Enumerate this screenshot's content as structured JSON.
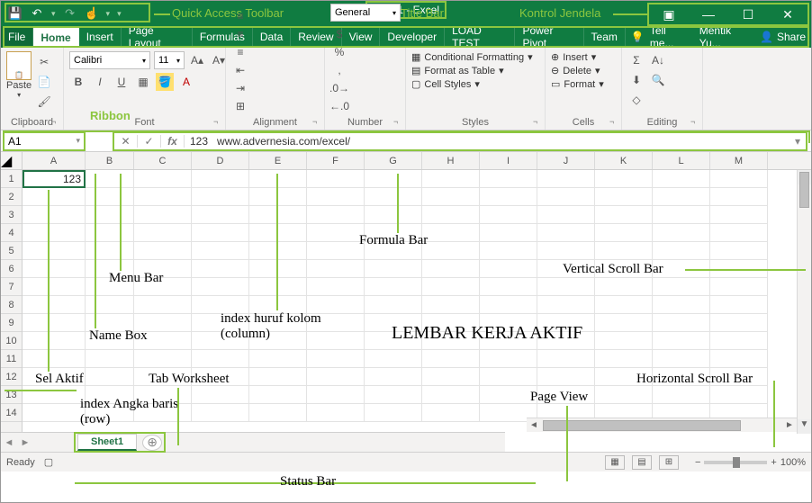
{
  "title": "Book1 - Excel",
  "qat": {
    "save": "💾",
    "undo": "↶",
    "redo": "↷",
    "touch": "☝"
  },
  "anno": {
    "qat": "Quick Access Toolbar",
    "titlebar": "Title Bar",
    "winctl": "Kontrol Jendela",
    "ribbon": "Ribbon",
    "formulabar": "Formula Bar",
    "menubar": "Menu Bar",
    "namebox": "Name Box",
    "colindex": "index huruf kolom (column)",
    "rowindex": "index Angka baris (row)",
    "selaktif": "Sel Aktif",
    "tabws": "Tab Worksheet",
    "lembar": "LEMBAR KERJA AKTIF",
    "vsb": "Vertical Scroll Bar",
    "hsb": "Horizontal Scroll Bar",
    "pageview": "Page View",
    "statusbar": "Status Bar"
  },
  "tabs": [
    "File",
    "Home",
    "Insert",
    "Page Layout",
    "Formulas",
    "Data",
    "Review",
    "View",
    "Developer",
    "LOAD TEST",
    "Power Pivot",
    "Team"
  ],
  "tellme": "Tell me...",
  "user": "Mentik Yu...",
  "share": "Share",
  "ribbon": {
    "clipboard": "Clipboard",
    "paste": "Paste",
    "font": "Font",
    "fontname": "Calibri",
    "fontsize": "11",
    "alignment": "Alignment",
    "number": "Number",
    "numfmt": "General",
    "styles": "Styles",
    "condfmt": "Conditional Formatting",
    "fmttable": "Format as Table",
    "cellstyles": "Cell Styles",
    "cells": "Cells",
    "insert": "Insert",
    "delete": "Delete",
    "format": "Format",
    "editing": "Editing"
  },
  "namebox": "A1",
  "fxvalue": "123",
  "fxtext": "www.advernesia.com/excel/",
  "cols": [
    "A",
    "B",
    "C",
    "D",
    "E",
    "F",
    "G",
    "H",
    "I",
    "J",
    "K",
    "L",
    "M"
  ],
  "rows": [
    "1",
    "2",
    "3",
    "4",
    "5",
    "6",
    "7",
    "8",
    "9",
    "10",
    "11",
    "12",
    "13",
    "14"
  ],
  "cellA1": "123",
  "sheet": "Sheet1",
  "status": "Ready",
  "zoom": "100%"
}
